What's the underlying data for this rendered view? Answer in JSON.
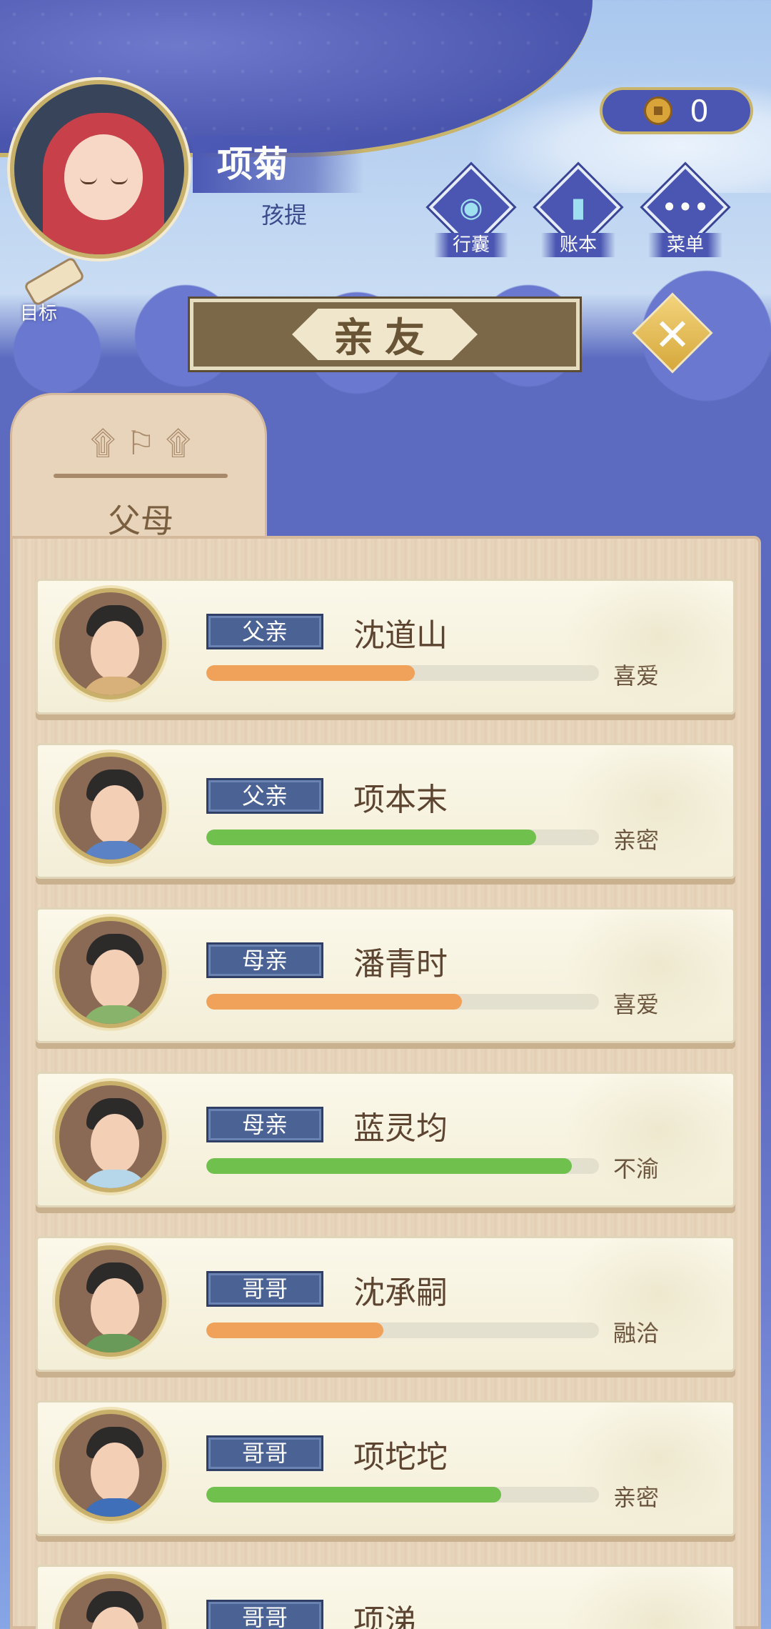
{
  "player": {
    "name": "项菊",
    "title": "孩提"
  },
  "currency": {
    "value": "0",
    "icon": "copper-coin-icon"
  },
  "top_menu": [
    {
      "label": "行囊",
      "icon": "bag-icon"
    },
    {
      "label": "账本",
      "icon": "ledger-icon"
    },
    {
      "label": "菜单",
      "icon": "more-dots-icon"
    }
  ],
  "goal_button": {
    "label": "目标",
    "icon": "scroll-icon"
  },
  "page_title": "亲友",
  "tab": {
    "label": "父母"
  },
  "colors": {
    "orange_bar": "#f0a25a",
    "green_bar": "#6fc04c",
    "badge_blue": "#4b6294"
  },
  "relatives": [
    {
      "relation": "父亲",
      "name": "沈道山",
      "status": "喜爱",
      "affection": 0.53,
      "bar_color": "#f0a25a",
      "robe": "#d7b07a"
    },
    {
      "relation": "父亲",
      "name": "项本末",
      "status": "亲密",
      "affection": 0.84,
      "bar_color": "#6fc04c",
      "robe": "#5b82c4"
    },
    {
      "relation": "母亲",
      "name": "潘青时",
      "status": "喜爱",
      "affection": 0.65,
      "bar_color": "#f0a25a",
      "robe": "#88b36a"
    },
    {
      "relation": "母亲",
      "name": "蓝灵均",
      "status": "不渝",
      "affection": 0.93,
      "bar_color": "#6fc04c",
      "robe": "#b6d6ea"
    },
    {
      "relation": "哥哥",
      "name": "沈承嗣",
      "status": "融洽",
      "affection": 0.45,
      "bar_color": "#f0a25a",
      "robe": "#6a9a5a"
    },
    {
      "relation": "哥哥",
      "name": "项坨坨",
      "status": "亲密",
      "affection": 0.75,
      "bar_color": "#6fc04c",
      "robe": "#3f6fb8"
    },
    {
      "relation": "哥哥",
      "name": "项涕",
      "status": "",
      "affection": null,
      "bar_color": "#f0a25a",
      "robe": "#3f6fb8"
    }
  ]
}
